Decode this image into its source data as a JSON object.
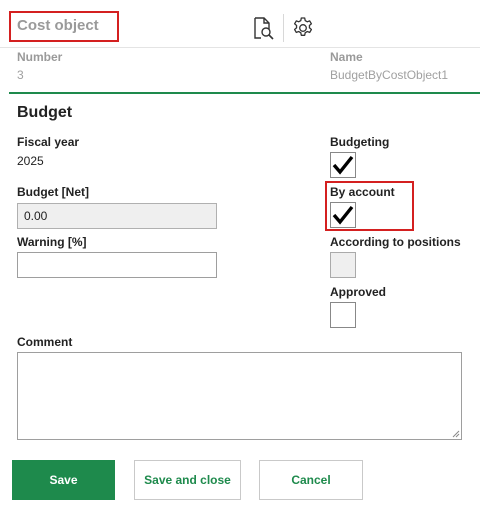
{
  "header": {
    "title": "Cost object",
    "icons": [
      "document-search-icon",
      "gear-icon"
    ]
  },
  "meta": {
    "number_label": "Number",
    "number_value": "3",
    "name_label": "Name",
    "name_value": "BudgetByCostObject1"
  },
  "budget": {
    "section_title": "Budget",
    "fiscal_year_label": "Fiscal year",
    "fiscal_year_value": "2025",
    "budget_net_label": "Budget [Net]",
    "budget_net_value": "0.00",
    "warning_label": "Warning [%]",
    "warning_value": "",
    "budgeting_label": "Budgeting",
    "budgeting_checked": true,
    "by_account_label": "By account",
    "by_account_checked": true,
    "according_positions_label": "According to positions",
    "according_positions_checked": false,
    "approved_label": "Approved",
    "approved_checked": false,
    "comment_label": "Comment",
    "comment_value": ""
  },
  "buttons": {
    "save": "Save",
    "save_and_close": "Save and close",
    "cancel": "Cancel"
  },
  "colors": {
    "accent_green": "#1e8a4c",
    "highlight_red": "#d42020"
  }
}
